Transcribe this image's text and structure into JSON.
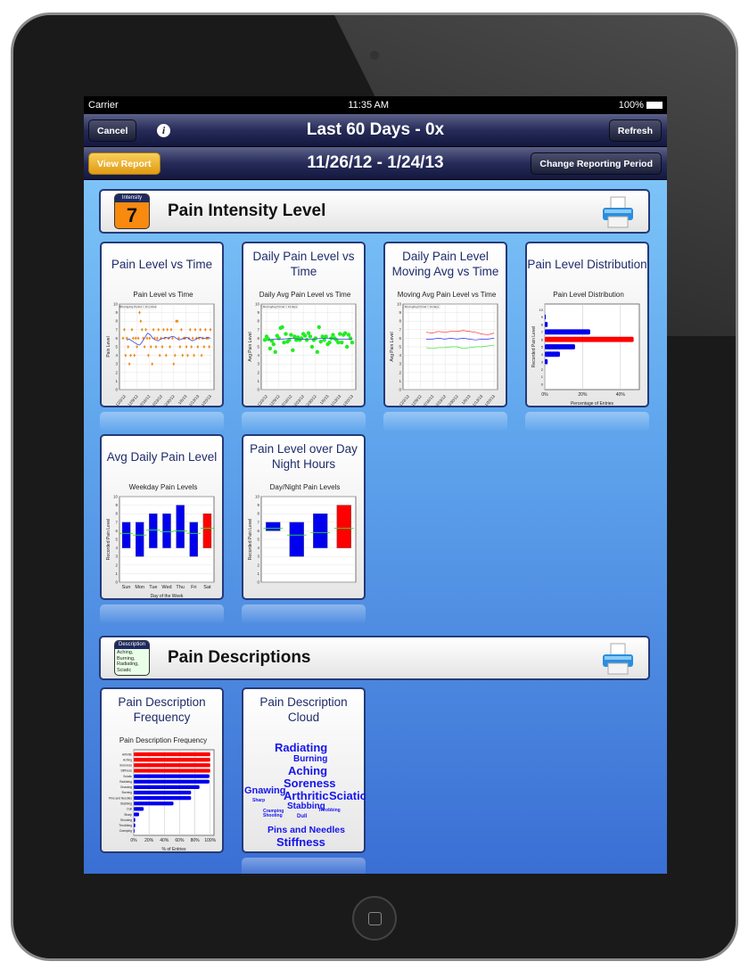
{
  "status": {
    "carrier": "Carrier",
    "time": "11:35 AM",
    "battery": "100%"
  },
  "nav": {
    "cancel": "Cancel",
    "title": "Last 60 Days - 0x",
    "refresh": "Refresh",
    "view_report": "View Report",
    "date_range": "11/26/12 - 1/24/13",
    "change_period": "Change Reporting Period"
  },
  "sections": [
    {
      "title": "Pain Intensity Level",
      "badge_header": "Intensity",
      "badge_value": "7"
    },
    {
      "title": "Pain Descriptions",
      "badge_header": "Description",
      "badge_text": "Aching, Burning, Radiating, Sciatic"
    }
  ],
  "cards": [
    {
      "title": "Pain Level vs Time"
    },
    {
      "title": "Daily Pain Level vs Time"
    },
    {
      "title": "Daily Pain Level Moving Avg vs Time"
    },
    {
      "title": "Pain Level Distribution"
    },
    {
      "title": "Avg Daily Pain Level"
    },
    {
      "title": "Pain Level over Day Night Hours"
    },
    {
      "title": "Pain Description Frequency"
    },
    {
      "title": "Pain Description Cloud"
    }
  ],
  "chart_data": [
    {
      "type": "scatter",
      "title": "Pain Level vs Time",
      "ylabel": "Pain Level",
      "ylim": [
        0,
        10
      ],
      "legend": "MovingAvg Period = 14 entries",
      "xticks": [
        "12/2/12",
        "12/9/12",
        "12/16/12",
        "12/23/12",
        "12/30/12",
        "1/6/13",
        "1/13/13",
        "1/20/13"
      ],
      "values": [
        6,
        7,
        4,
        6,
        5,
        3,
        4,
        7,
        6,
        4,
        6,
        5,
        6,
        9,
        8,
        7,
        6,
        5,
        7,
        6,
        4,
        6,
        5,
        3,
        7,
        6,
        5,
        6,
        7,
        4,
        6,
        5,
        7,
        6,
        4,
        7,
        6,
        5,
        7,
        6,
        3,
        4,
        8,
        8,
        6,
        5,
        7,
        4,
        6,
        6,
        5,
        4,
        6,
        7,
        5,
        6,
        4,
        7,
        6,
        5,
        6,
        7,
        4,
        6,
        5,
        7,
        6,
        6,
        5,
        7
      ],
      "moving_avg": [
        5.8,
        5.9,
        5.7,
        5.5,
        5.3,
        5.2,
        5.6,
        6.1,
        6.6,
        6.4,
        6.0,
        5.8,
        5.7,
        5.9,
        6.0,
        6.1,
        6.0,
        6.2,
        6.2,
        6.0,
        5.8,
        5.9,
        6.0,
        6.1,
        5.9,
        5.7,
        5.8,
        6.0,
        6.1,
        6.0,
        6.0,
        6.1,
        6.0
      ]
    },
    {
      "type": "scatter",
      "title": "Daily Avg Pain Level vs Time",
      "ylabel": "Avg Pain Level",
      "ylim": [
        0,
        10
      ],
      "legend": "MovingAvg Period = 14 days",
      "xticks": [
        "12/2/12",
        "12/9/12",
        "12/16/12",
        "12/23/12",
        "12/30/12",
        "1/6/13",
        "1/13/13",
        "1/20/13"
      ],
      "values": [
        5.8,
        6.2,
        5.9,
        4.8,
        5.7,
        5.3,
        4.4,
        6.3,
        6.0,
        7.2,
        7.3,
        5.5,
        6.5,
        5.6,
        5.8,
        6.4,
        4.6,
        6.2,
        5.8,
        6.1,
        5.8,
        6.0,
        6.5,
        6.3,
        5.8,
        6.6,
        6.2,
        5.0,
        5.8,
        6.0,
        4.4,
        7.3,
        5.6,
        6.2,
        5.8,
        6.2,
        5.3,
        5.5,
        6.0,
        6.4,
        6.0,
        5.8,
        5.5,
        6.5,
        5.5,
        6.4,
        6.6,
        5.0,
        6.4,
        6.0,
        5.5
      ],
      "moving_avg": [
        5.8,
        5.9,
        5.9,
        6.0,
        5.9,
        5.9,
        5.9,
        6.0,
        6.0,
        5.9,
        5.9,
        5.9
      ]
    },
    {
      "type": "line",
      "title": "Moving Avg Pain Level vs Time",
      "ylabel": "Avg Pain Level",
      "ylim": [
        0,
        10
      ],
      "legend": "MovingAvg Period = 14 days",
      "xticks": [
        "12/2/12",
        "12/9/12",
        "12/16/12",
        "12/23/12",
        "12/30/12",
        "1/6/13",
        "1/13/13",
        "1/20/13"
      ],
      "series": [
        {
          "color": "#ff3030",
          "values": [
            6.7,
            6.6,
            6.8,
            6.7,
            6.8,
            6.8,
            6.9,
            6.8,
            6.7,
            6.5,
            6.4,
            6.6
          ]
        },
        {
          "color": "#3030ff",
          "values": [
            5.9,
            5.9,
            6.0,
            5.9,
            6.0,
            5.9,
            6.0,
            5.9,
            5.8,
            5.9,
            5.9,
            6.0
          ]
        },
        {
          "color": "#30e030",
          "values": [
            4.9,
            4.8,
            4.9,
            4.9,
            5.0,
            5.0,
            4.8,
            4.9,
            5.0,
            5.0,
            5.1,
            5.2
          ]
        }
      ]
    },
    {
      "type": "bar",
      "orientation": "horizontal",
      "title": "Pain Level Distribution",
      "ylabel": "Recorded Pain Level",
      "xlabel": "Percentage of Entries",
      "categories": [
        "0",
        "1",
        "2",
        "3",
        "4",
        "5",
        "6",
        "7",
        "8",
        "9",
        "10"
      ],
      "values": [
        0,
        0,
        0,
        1.5,
        8,
        16,
        47,
        24,
        1.5,
        0.5,
        0
      ],
      "highlight": "6",
      "xticks": [
        "0%",
        "20%",
        "40%"
      ],
      "xlim": [
        0,
        50
      ]
    },
    {
      "type": "range-bar",
      "title": "Weekday Pain Levels",
      "ylabel": "Recorded Pain Level",
      "xlabel": "Day of the Week",
      "ylim": [
        0,
        10
      ],
      "categories": [
        "Sun",
        "Mon",
        "Tue",
        "Wed",
        "Thu",
        "Fri",
        "Sat"
      ],
      "min": [
        4,
        3,
        4,
        4,
        4,
        3,
        4
      ],
      "max": [
        7,
        7,
        8,
        8,
        9,
        7,
        8
      ],
      "avg": [
        5.7,
        5.5,
        6.1,
        5.9,
        6.0,
        5.7,
        6.3
      ],
      "highlight": "Sat"
    },
    {
      "type": "range-bar",
      "title": "Day/Night Pain Levels",
      "ylabel": "Recorded Pain Level",
      "ylim": [
        0,
        10
      ],
      "categories": [
        "",
        "",
        "",
        ""
      ],
      "min": [
        6,
        3,
        4,
        4
      ],
      "max": [
        7,
        7,
        8,
        9
      ],
      "avg": [
        6.3,
        5.5,
        5.8,
        6.3
      ],
      "highlight_index": 3
    },
    {
      "type": "bar",
      "orientation": "horizontal",
      "title": "Pain Description Frequency",
      "xlabel": "% of Entries",
      "categories": [
        "Arthritic",
        "Aching",
        "Soreness",
        "Stiffness",
        "Sciatic",
        "Radiating",
        "Gnawing",
        "Burning",
        "Pins and Needles",
        "Stabbing",
        "Dull",
        "Sharp",
        "Shooting",
        "Throbbing",
        "Cramping"
      ],
      "values": [
        100,
        100,
        100,
        100,
        99,
        99,
        86,
        75,
        75,
        52,
        13,
        7,
        2,
        2,
        1
      ],
      "highlight_count": 4,
      "xticks": [
        "0%",
        "20%",
        "40%",
        "60%",
        "80%",
        "100%"
      ],
      "xlim": [
        0,
        105
      ]
    }
  ],
  "word_cloud": [
    {
      "text": "Radiating",
      "size": 13
    },
    {
      "text": "Burning",
      "size": 10
    },
    {
      "text": "Aching",
      "size": 13
    },
    {
      "text": "Soreness",
      "size": 13
    },
    {
      "text": "Gnawing",
      "size": 11
    },
    {
      "text": "Arthritic",
      "size": 13
    },
    {
      "text": "Sciatic",
      "size": 13
    },
    {
      "text": "Sharp",
      "size": 5
    },
    {
      "text": "Stabbing",
      "size": 10
    },
    {
      "text": "Cramping",
      "size": 5
    },
    {
      "text": "Throbbing",
      "size": 5
    },
    {
      "text": "Shooting",
      "size": 5
    },
    {
      "text": "Dull",
      "size": 6
    },
    {
      "text": "Pins and Needles",
      "size": 10.5
    },
    {
      "text": "Stiffness",
      "size": 13
    }
  ],
  "colors": {
    "nav_dark": "#1a1e48",
    "accent_yellow": "#f0b020",
    "card_border": "#243a78",
    "highlight_bar": "#ff0000",
    "bar": "#0000ee",
    "avg_line": "#30e030",
    "scatter_orange": "#f08a10",
    "scatter_green": "#20ee20"
  }
}
